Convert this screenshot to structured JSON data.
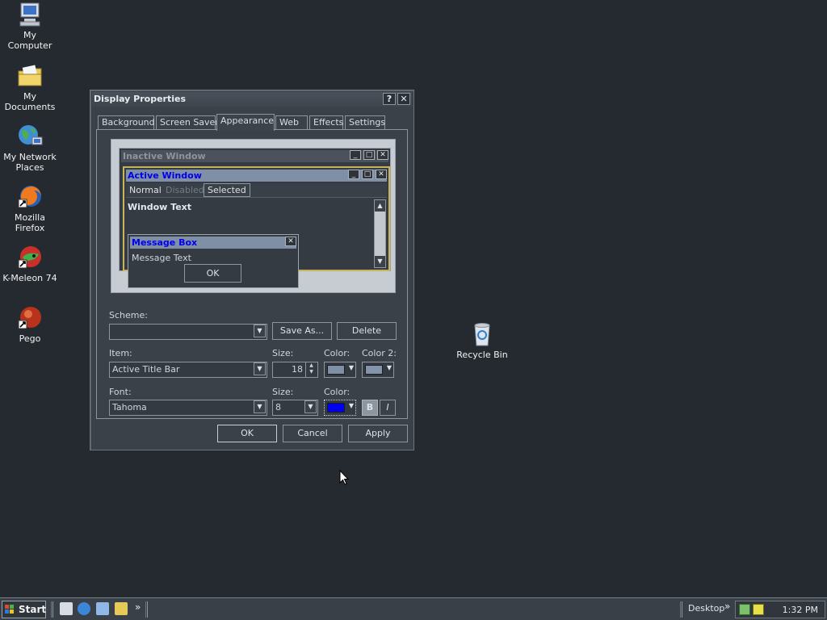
{
  "desktop": {
    "icons": [
      {
        "label": "My Computer",
        "icon": "computer-icon"
      },
      {
        "label": "My Documents",
        "icon": "folder-icon"
      },
      {
        "label": "My Network Places",
        "icon": "network-icon"
      },
      {
        "label": "Mozilla Firefox",
        "icon": "firefox-icon"
      },
      {
        "label": "K-Meleon 74",
        "icon": "kmeleon-icon"
      },
      {
        "label": "Pego",
        "icon": "pego-icon"
      },
      {
        "label": "Recycle Bin",
        "icon": "recycle-bin-icon"
      }
    ]
  },
  "dialog": {
    "title": "Display Properties",
    "help_button": "?",
    "close_button": "✕",
    "tabs": [
      {
        "label": "Background"
      },
      {
        "label": "Screen Saver"
      },
      {
        "label": "Appearance",
        "active": true
      },
      {
        "label": "Web"
      },
      {
        "label": "Effects"
      },
      {
        "label": "Settings"
      }
    ],
    "preview": {
      "inactive_window": "Inactive Window",
      "active_window": "Active Window",
      "menu": [
        "Normal",
        "Disabled",
        "Selected"
      ],
      "window_text": "Window Text",
      "message_box_title": "Message Box",
      "message_text": "Message Text",
      "ok": "OK"
    },
    "scheme_label": "Scheme:",
    "scheme_value": "",
    "save_as": "Save As...",
    "delete": "Delete",
    "item_label": "Item:",
    "item_value": "Active Title Bar",
    "item_size_label": "Size:",
    "item_size_value": "18",
    "item_color_label": "Color:",
    "item_color2_label": "Color 2:",
    "item_color": "#7f8fa6",
    "item_color2": "#8293aa",
    "font_label": "Font:",
    "font_value": "Tahoma",
    "font_size_label": "Size:",
    "font_size_value": "8",
    "font_color_label": "Color:",
    "font_color": "#0000ee",
    "bold": "B",
    "italic": "I",
    "ok": "OK",
    "cancel": "Cancel",
    "apply": "Apply"
  },
  "taskbar": {
    "start": "Start",
    "quick_launch_more": "»",
    "toolbar_label": "Desktop",
    "toolbar_more": "»",
    "clock": "1:32 PM"
  }
}
